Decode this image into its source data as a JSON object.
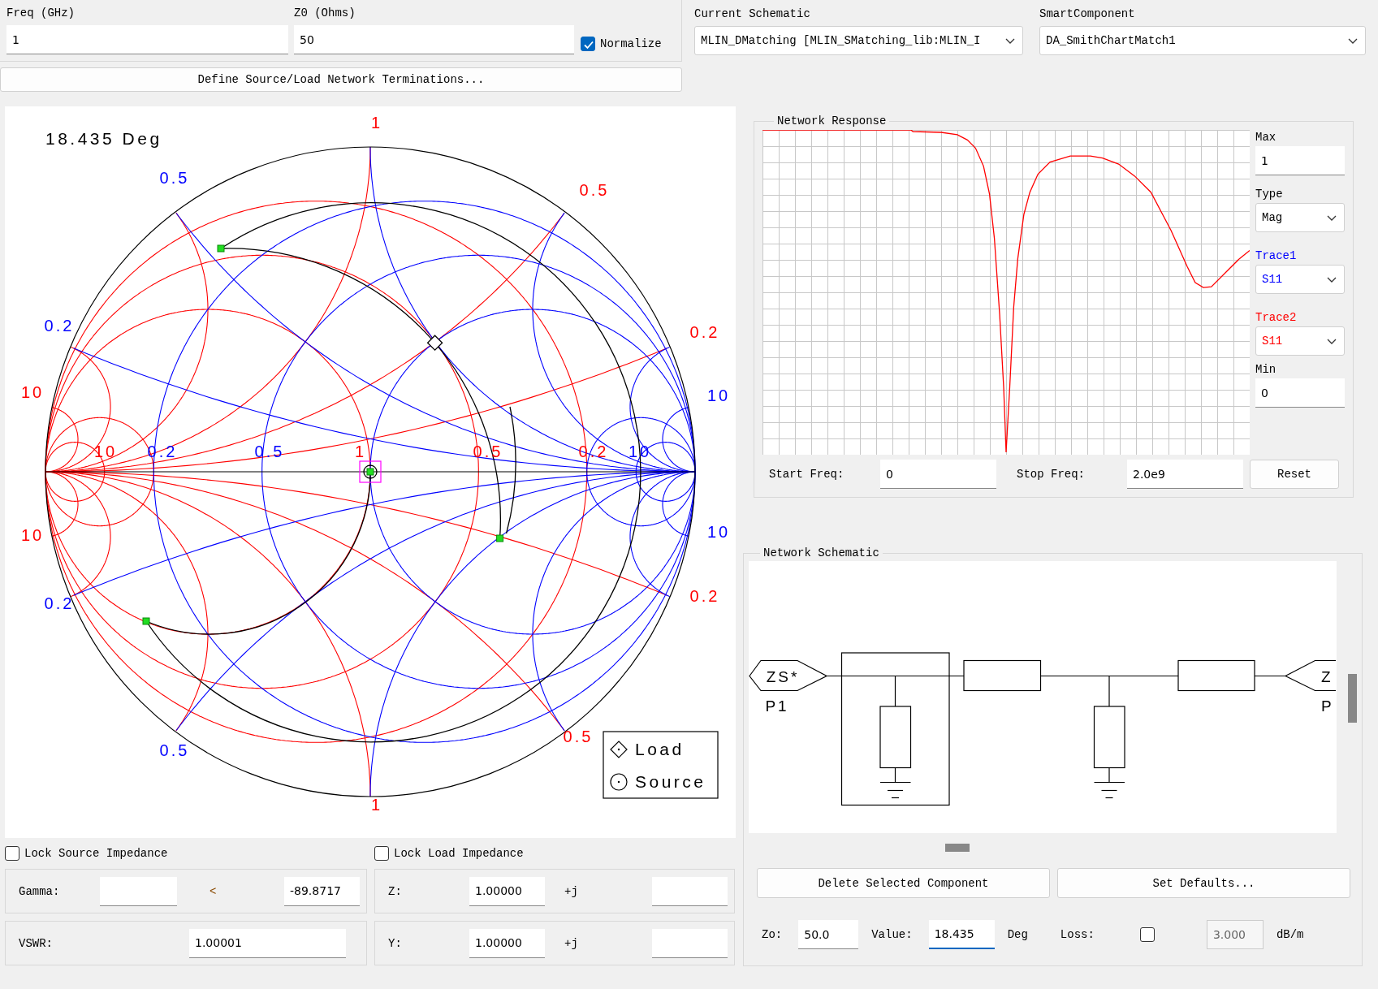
{
  "frequency": {
    "label": "Freq (GHz)",
    "value": "1"
  },
  "z0": {
    "label": "Z0 (Ohms)",
    "value": "50"
  },
  "normalize": {
    "label": "Normalize",
    "checked": true
  },
  "define_button": "Define Source/Load Network Terminations...",
  "current_schematic": {
    "label": "Current Schematic",
    "value": "MLIN_DMatching [MLIN_SMatching_lib:MLIN_I"
  },
  "smart_component": {
    "label": "SmartComponent",
    "value": "DA_SmithChartMatch1"
  },
  "smith_chart": {
    "readout": "18.435 Deg",
    "scale_labels": [
      {
        "text": "1",
        "color": "#ff0000"
      },
      {
        "text": "0.5",
        "color": "#0000ff"
      },
      {
        "text": "0.5",
        "color": "#ff0000"
      },
      {
        "text": "0.2",
        "color": "#0000ff"
      },
      {
        "text": "0.2",
        "color": "#ff0000"
      },
      {
        "text": "10",
        "color": "#ff0000"
      },
      {
        "text": "10",
        "color": "#0000ff"
      },
      {
        "text": "10",
        "color": "#ff0000"
      },
      {
        "text": "0.2",
        "color": "#0000ff"
      },
      {
        "text": "0.5",
        "color": "#0000ff"
      },
      {
        "text": "1",
        "color": "#ff0000"
      },
      {
        "text": "0.5",
        "color": "#ff0000"
      },
      {
        "text": "0.2",
        "color": "#ff0000"
      },
      {
        "text": "10",
        "color": "#0000ff"
      },
      {
        "text": "10",
        "color": "#ff0000"
      },
      {
        "text": "10",
        "color": "#0000ff"
      },
      {
        "text": "0.2",
        "color": "#0000ff"
      },
      {
        "text": "0.2",
        "color": "#ff0000"
      },
      {
        "text": "0.5",
        "color": "#0000ff"
      },
      {
        "text": "0.5",
        "color": "#ff0000"
      },
      {
        "text": "1",
        "color": "#ff0000"
      }
    ],
    "legend": [
      {
        "kind": "diamond",
        "label": "Load"
      },
      {
        "kind": "circle",
        "label": "Source"
      }
    ]
  },
  "lock_source": {
    "label": "Lock Source Impedance",
    "checked": false
  },
  "lock_load": {
    "label": "Lock Load Impedance",
    "checked": false
  },
  "gamma": {
    "label": "Gamma:",
    "angle_symbol": "<",
    "angle": "-89.8717"
  },
  "z": {
    "label": "Z:",
    "real": "1.00000",
    "imag_prefix": "+j"
  },
  "vswr": {
    "label": "VSWR:",
    "value": "1.00001"
  },
  "y": {
    "label": "Y:",
    "real": "1.00000",
    "imag_prefix": "+j"
  },
  "network_response": {
    "title": "Network Response",
    "max": {
      "label": "Max",
      "value": "1"
    },
    "type": {
      "label": "Type",
      "value": "Mag"
    },
    "traces": [
      {
        "label": "Trace1",
        "value": "S11",
        "color": "#0000ff"
      },
      {
        "label": "Trace2",
        "value": "S11",
        "color": "#ff0000"
      }
    ],
    "min": {
      "label": "Min",
      "value": "0"
    },
    "start_freq": {
      "label": "Start Freq:",
      "value": "0"
    },
    "stop_freq": {
      "label": "Stop Freq:",
      "value": "2.0e9"
    },
    "reset_button": "Reset"
  },
  "network_schematic": {
    "title": "Network Schematic",
    "ports": [
      {
        "symbol": "ZS*",
        "name": "P1"
      },
      {
        "symbol": "Z",
        "name": "P"
      }
    ],
    "buttons": [
      "Delete Selected Component",
      "Set Defaults..."
    ],
    "zo": {
      "label": "Zo:",
      "value": "50.0"
    },
    "value": {
      "label": "Value:",
      "value": "18.435",
      "unit": "Deg",
      "focused": true
    },
    "loss": {
      "label": "Loss:",
      "checked": false,
      "value": "3.000",
      "unit": "dB/m",
      "disabled": true
    }
  }
}
